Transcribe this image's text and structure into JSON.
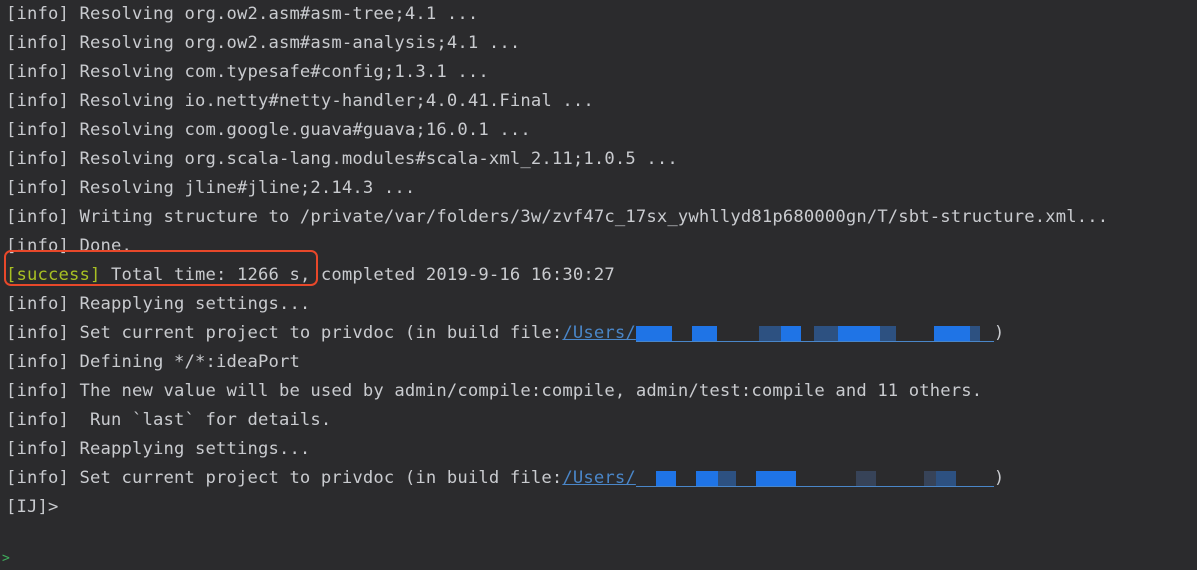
{
  "terminal": {
    "lines": [
      "[info] Resolving org.ow2.asm#asm-tree;4.1 ...",
      "[info] Resolving org.ow2.asm#asm-analysis;4.1 ...",
      "[info] Resolving com.typesafe#config;1.3.1 ...",
      "[info] Resolving io.netty#netty-handler;4.0.41.Final ...",
      "[info] Resolving com.google.guava#guava;16.0.1 ...",
      "[info] Resolving org.scala-lang.modules#scala-xml_2.11;1.0.5 ...",
      "[info] Resolving jline#jline;2.14.3 ...",
      "[info] Writing structure to /private/var/folders/3w/zvf47c_17sx_ywhllyd81p680000gn/T/sbt-structure.xml...",
      "[info] Done."
    ],
    "success_line": {
      "tag": "[success]",
      "text": " Total time: 1266 s, completed 2019-9-16 16:30:27"
    },
    "lines_2": [
      "[info] Reapplying settings..."
    ],
    "project_line_1": {
      "prefix": "[info] Set current project to privdoc (in build file:",
      "link": "/Users/",
      "suffix": ")"
    },
    "lines_3": [
      "[info] Defining */*:ideaPort",
      "[info] The new value will be used by admin/compile:compile, admin/test:compile and 11 others.",
      "[info]  Run `last` for details.",
      "[info] Reapplying settings..."
    ],
    "project_line_2": {
      "prefix": "[info] Set current project to privdoc (in build file:",
      "link": "/Users/",
      "suffix": ")"
    },
    "prompt": "[IJ]>",
    "bottom_prompt_glyph": ">"
  },
  "colors": {
    "background": "#2b2b2d",
    "text": "#c9cbcf",
    "success": "#a8c023",
    "link": "#4a86c8",
    "highlight_border": "#e8482a",
    "prompt_green": "#3fae5c"
  }
}
